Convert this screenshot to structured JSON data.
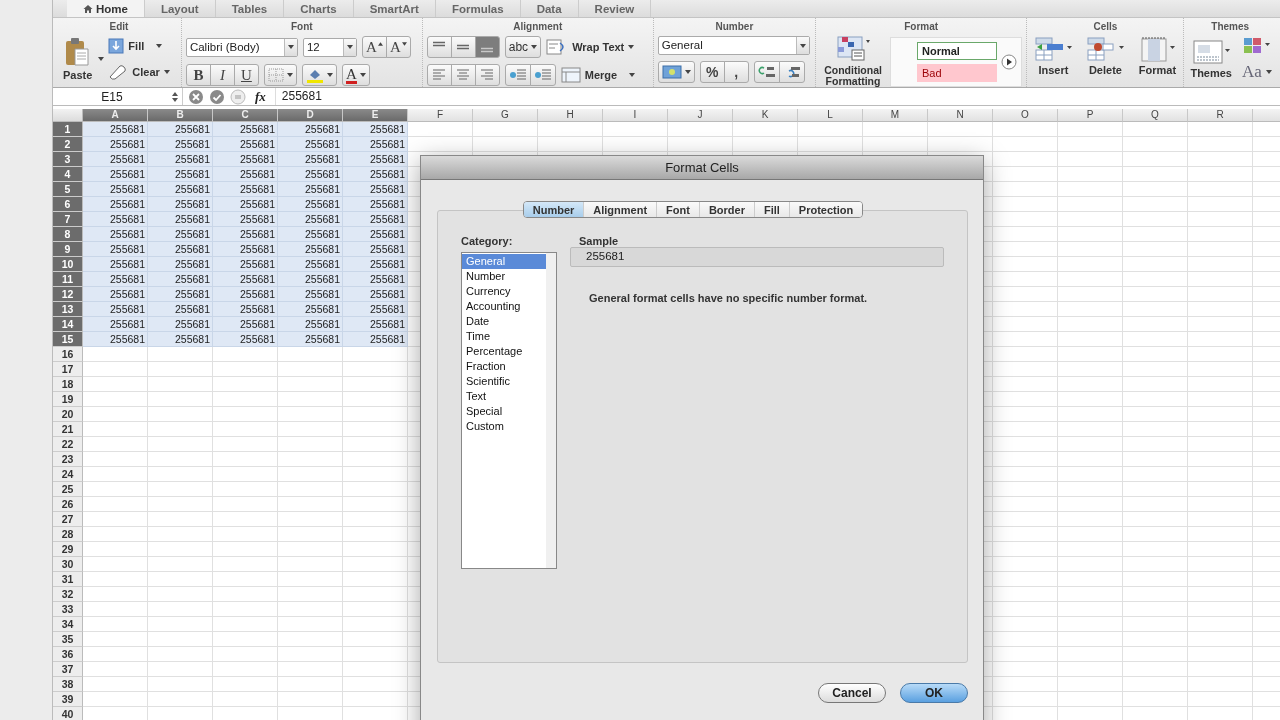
{
  "ribbon_tabs": [
    {
      "label": "Home",
      "selected": true
    },
    {
      "label": "Layout",
      "selected": false
    },
    {
      "label": "Tables",
      "selected": false
    },
    {
      "label": "Charts",
      "selected": false
    },
    {
      "label": "SmartArt",
      "selected": false
    },
    {
      "label": "Formulas",
      "selected": false
    },
    {
      "label": "Data",
      "selected": false
    },
    {
      "label": "Review",
      "selected": false
    }
  ],
  "ribbon": {
    "edit": {
      "title": "Edit",
      "paste": "Paste",
      "fill": "Fill",
      "clear": "Clear"
    },
    "font": {
      "title": "Font",
      "font_name": "Calibri (Body)",
      "font_size": "12",
      "grow": "A",
      "shrink": "A",
      "bold": "B",
      "italic": "I",
      "underline": "U",
      "font_color": "A"
    },
    "alignment": {
      "title": "Alignment",
      "vertical_align": [
        {
          "selected": false
        },
        {
          "selected": false
        },
        {
          "selected": true
        }
      ],
      "orientation": "abc",
      "wrap_text": "Wrap Text",
      "merge": "Merge"
    },
    "number": {
      "title": "Number",
      "format": "General",
      "percent": "%",
      "comma": ","
    },
    "format": {
      "title": "Format",
      "conditional_formatting": "Conditional Formatting",
      "styles": [
        {
          "label": "Normal",
          "color": "#ffffff"
        },
        {
          "label": "Bad",
          "color": "#ffc7ce"
        }
      ]
    },
    "cells": {
      "title": "Cells",
      "insert": "Insert",
      "delete": "Delete",
      "format": "Format"
    },
    "themes": {
      "title": "Themes",
      "themes": "Themes",
      "fonts": "Aa"
    }
  },
  "formula_bar": {
    "name_box": "E15",
    "fx": "fx",
    "value": "255681"
  },
  "sheet": {
    "columns": [
      {
        "label": "A",
        "selected": true
      },
      {
        "label": "B",
        "selected": true
      },
      {
        "label": "C",
        "selected": true
      },
      {
        "label": "D",
        "selected": true
      },
      {
        "label": "E",
        "selected": true
      },
      {
        "label": "F",
        "selected": false
      },
      {
        "label": "G",
        "selected": false
      },
      {
        "label": "H",
        "selected": false
      },
      {
        "label": "I",
        "selected": false
      },
      {
        "label": "J",
        "selected": false
      },
      {
        "label": "K",
        "selected": false
      },
      {
        "label": "L",
        "selected": false
      },
      {
        "label": "M",
        "selected": false
      },
      {
        "label": "N",
        "selected": false
      },
      {
        "label": "O",
        "selected": false
      },
      {
        "label": "P",
        "selected": false
      },
      {
        "label": "Q",
        "selected": false
      },
      {
        "label": "R",
        "selected": false
      }
    ],
    "rows": [
      {
        "label": "1",
        "selected": true,
        "cells": [
          "255681",
          "255681",
          "255681",
          "255681",
          "255681"
        ]
      },
      {
        "label": "2",
        "selected": true,
        "cells": [
          "255681",
          "255681",
          "255681",
          "255681",
          "255681"
        ]
      },
      {
        "label": "3",
        "selected": true,
        "cells": [
          "255681",
          "255681",
          "255681",
          "255681",
          "255681"
        ]
      },
      {
        "label": "4",
        "selected": true,
        "cells": [
          "255681",
          "255681",
          "255681",
          "255681",
          "255681"
        ]
      },
      {
        "label": "5",
        "selected": true,
        "cells": [
          "255681",
          "255681",
          "255681",
          "255681",
          "255681"
        ]
      },
      {
        "label": "6",
        "selected": true,
        "cells": [
          "255681",
          "255681",
          "255681",
          "255681",
          "255681"
        ]
      },
      {
        "label": "7",
        "selected": true,
        "cells": [
          "255681",
          "255681",
          "255681",
          "255681",
          "255681"
        ]
      },
      {
        "label": "8",
        "selected": true,
        "cells": [
          "255681",
          "255681",
          "255681",
          "255681",
          "255681"
        ]
      },
      {
        "label": "9",
        "selected": true,
        "cells": [
          "255681",
          "255681",
          "255681",
          "255681",
          "255681"
        ]
      },
      {
        "label": "10",
        "selected": true,
        "cells": [
          "255681",
          "255681",
          "255681",
          "255681",
          "255681"
        ]
      },
      {
        "label": "11",
        "selected": true,
        "cells": [
          "255681",
          "255681",
          "255681",
          "255681",
          "255681"
        ]
      },
      {
        "label": "12",
        "selected": true,
        "cells": [
          "255681",
          "255681",
          "255681",
          "255681",
          "255681"
        ]
      },
      {
        "label": "13",
        "selected": true,
        "cells": [
          "255681",
          "255681",
          "255681",
          "255681",
          "255681"
        ]
      },
      {
        "label": "14",
        "selected": true,
        "cells": [
          "255681",
          "255681",
          "255681",
          "255681",
          "255681"
        ]
      },
      {
        "label": "15",
        "selected": true,
        "cells": [
          "255681",
          "255681",
          "255681",
          "255681",
          "255681"
        ]
      },
      {
        "label": "16",
        "selected": false
      },
      {
        "label": "17",
        "selected": false
      },
      {
        "label": "18",
        "selected": false
      },
      {
        "label": "19",
        "selected": false
      },
      {
        "label": "20",
        "selected": false
      },
      {
        "label": "21",
        "selected": false
      },
      {
        "label": "22",
        "selected": false
      },
      {
        "label": "23",
        "selected": false
      },
      {
        "label": "24",
        "selected": false
      },
      {
        "label": "25",
        "selected": false
      },
      {
        "label": "26",
        "selected": false
      },
      {
        "label": "27",
        "selected": false
      },
      {
        "label": "28",
        "selected": false
      },
      {
        "label": "29",
        "selected": false
      },
      {
        "label": "30",
        "selected": false
      },
      {
        "label": "31",
        "selected": false
      },
      {
        "label": "32",
        "selected": false
      },
      {
        "label": "33",
        "selected": false
      },
      {
        "label": "34",
        "selected": false
      },
      {
        "label": "35",
        "selected": false
      },
      {
        "label": "36",
        "selected": false
      },
      {
        "label": "37",
        "selected": false
      },
      {
        "label": "38",
        "selected": false
      },
      {
        "label": "39",
        "selected": false
      },
      {
        "label": "40",
        "selected": false
      }
    ]
  },
  "dialog": {
    "title": "Format Cells",
    "tabs": [
      {
        "label": "Number",
        "selected": true
      },
      {
        "label": "Alignment",
        "selected": false
      },
      {
        "label": "Font",
        "selected": false
      },
      {
        "label": "Border",
        "selected": false
      },
      {
        "label": "Fill",
        "selected": false
      },
      {
        "label": "Protection",
        "selected": false
      }
    ],
    "category_label": "Category:",
    "categories": [
      {
        "label": "General",
        "selected": true
      },
      {
        "label": "Number",
        "selected": false
      },
      {
        "label": "Currency",
        "selected": false
      },
      {
        "label": "Accounting",
        "selected": false
      },
      {
        "label": "Date",
        "selected": false
      },
      {
        "label": "Time",
        "selected": false
      },
      {
        "label": "Percentage",
        "selected": false
      },
      {
        "label": "Fraction",
        "selected": false
      },
      {
        "label": "Scientific",
        "selected": false
      },
      {
        "label": "Text",
        "selected": false
      },
      {
        "label": "Special",
        "selected": false
      },
      {
        "label": "Custom",
        "selected": false
      }
    ],
    "sample_label": "Sample",
    "sample_value": "255681",
    "description": "General format cells have no specific number format.",
    "buttons": [
      "Cancel",
      "OK"
    ]
  }
}
